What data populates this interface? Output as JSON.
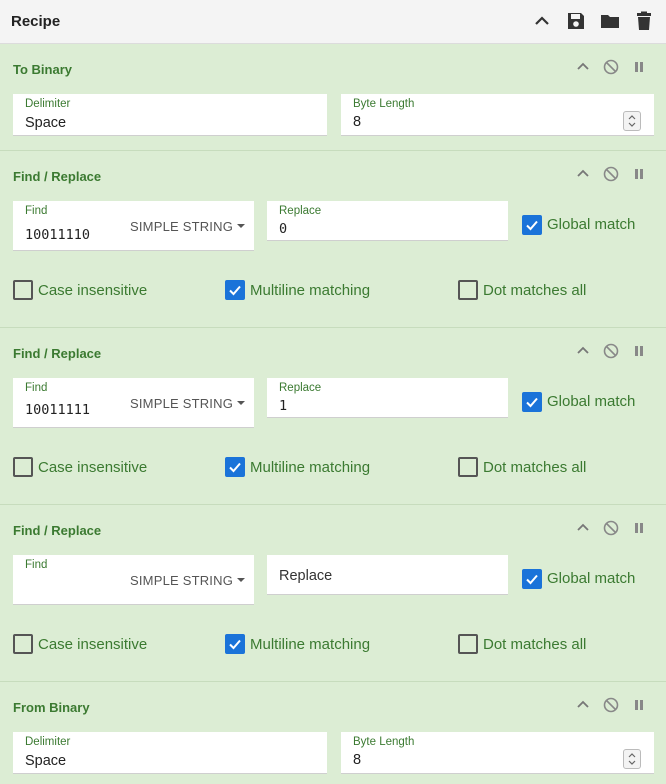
{
  "header": {
    "title": "Recipe"
  },
  "to_binary": {
    "title": "To Binary",
    "delimiter_label": "Delimiter",
    "delimiter_value": "Space",
    "byte_length_label": "Byte Length",
    "byte_length_value": "8"
  },
  "find_replace": [
    {
      "title": "Find / Replace",
      "find_label": "Find",
      "find_value": "10011110",
      "find_mode": "SIMPLE STRING",
      "replace_label": "Replace",
      "replace_value": "0",
      "global_match": "Global match",
      "case_insensitive": "Case insensitive",
      "multiline": "Multiline matching",
      "dot_matches": "Dot matches all"
    },
    {
      "title": "Find / Replace",
      "find_label": "Find",
      "find_value": "10011111",
      "find_mode": "SIMPLE STRING",
      "replace_label": "Replace",
      "replace_value": "1",
      "global_match": "Global match",
      "case_insensitive": "Case insensitive",
      "multiline": "Multiline matching",
      "dot_matches": "Dot matches all"
    },
    {
      "title": "Find / Replace",
      "find_label": "Find",
      "find_value": "",
      "find_mode": "SIMPLE STRING",
      "replace_placeholder": "Replace",
      "global_match": "Global match",
      "case_insensitive": "Case insensitive",
      "multiline": "Multiline matching",
      "dot_matches": "Dot matches all"
    }
  ],
  "from_binary": {
    "title": "From Binary",
    "delimiter_label": "Delimiter",
    "delimiter_value": "Space",
    "byte_length_label": "Byte Length",
    "byte_length_value": "8"
  },
  "colors": {
    "op_background": "#dcedd4",
    "op_title": "#3b7a31",
    "checkbox_checked": "#1a73d9"
  },
  "icons": {
    "header": [
      "chevron-up-icon",
      "save-icon",
      "folder-icon",
      "trash-icon"
    ],
    "operation": [
      "chevron-up-icon",
      "disable-icon",
      "pause-icon"
    ]
  }
}
